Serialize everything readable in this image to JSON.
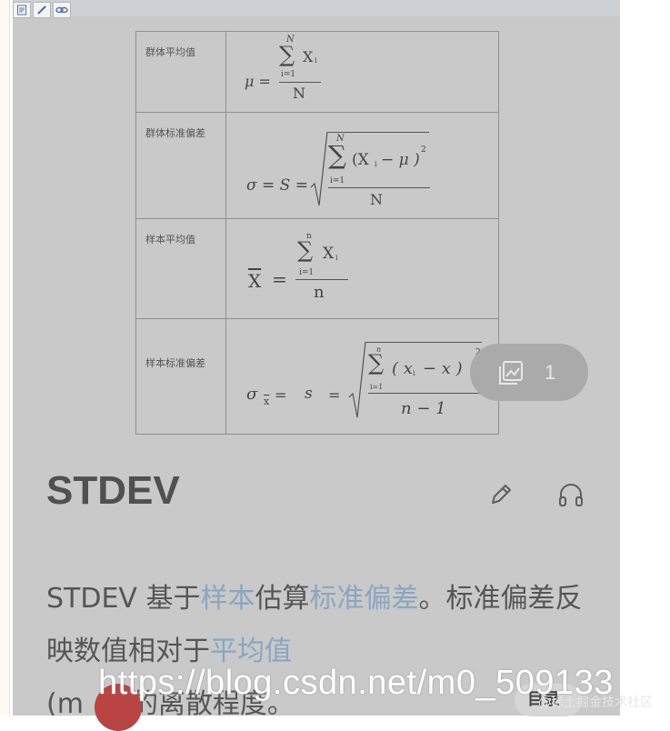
{
  "toolbar": {
    "buttons": [
      "note-icon",
      "pencil-icon",
      "link-icon"
    ]
  },
  "formula_table": {
    "rows": [
      {
        "label": "群体平均值"
      },
      {
        "label": "群体标准偏差"
      },
      {
        "label": "样本平均值"
      },
      {
        "label": "样本标准偏差"
      }
    ],
    "formulas": {
      "r1": {
        "sup": "N",
        "sum": "∑",
        "term": "X",
        "sub": "i",
        "lower": "i=1",
        "mu": "μ =",
        "den": "N"
      },
      "r2": {
        "lhs": "σ = S =",
        "sup": "N",
        "sum": "∑",
        "term": "(X",
        "sub": "i",
        "rest": "− μ )",
        "pow": "2",
        "lower": "i=1",
        "den": "N"
      },
      "r3": {
        "lhs": "X",
        "eq": "=",
        "sup": "n",
        "sum": "∑",
        "term": "X",
        "sub": "i",
        "lower": "i=1",
        "den": "n"
      },
      "r4": {
        "sigma": "σ",
        "sigma_sub": "x",
        "eq1": "=",
        "s": "s",
        "eq2": "=",
        "sup": "n",
        "sum": "∑",
        "term": "( x",
        "sub": "i",
        "rest": "− x )",
        "pow": "2",
        "lower": "i=1",
        "den": "n − 1"
      }
    }
  },
  "image_counter": {
    "count": "1"
  },
  "article": {
    "title": "STDEV",
    "para": {
      "p1": "STDEV 基于",
      "l1": "样本",
      "p2": "估算",
      "l2": "标准偏差",
      "p3": "。标准偏差反映数值相对于",
      "l3": "平均值",
      "p4": "(m",
      "p5": "的离散程度。"
    }
  },
  "toc_badge": "目录",
  "watermarks": {
    "url": "https://blog.csdn.net/m0_509133",
    "source": "@稀土掘金技术社区"
  },
  "colors": {
    "link": "#8aa5c0",
    "panel": "#c9c9c9",
    "pill": "#aaaaaa"
  }
}
